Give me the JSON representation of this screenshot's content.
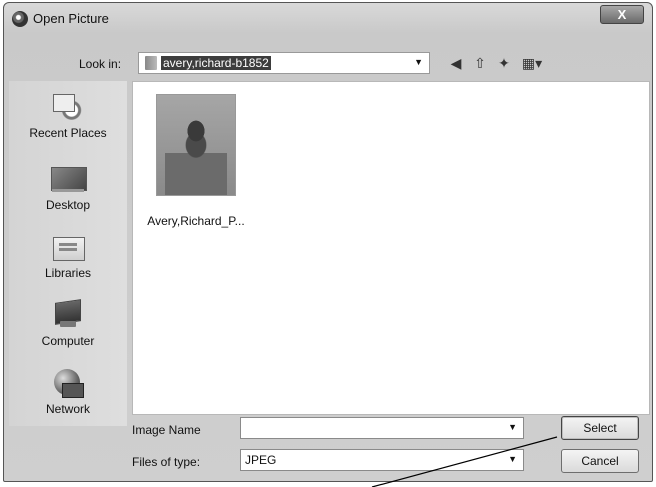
{
  "window": {
    "title": "Open Picture",
    "close_label": "X"
  },
  "toolbar": {
    "look_in_label": "Look in:",
    "look_in_value": "avery,richard-b1852",
    "icons": [
      "back-icon",
      "up-folder-icon",
      "new-folder-icon",
      "view-menu-icon"
    ]
  },
  "places": [
    {
      "label": "Recent Places",
      "icon": "recent-places-icon"
    },
    {
      "label": "Desktop",
      "icon": "desktop-icon"
    },
    {
      "label": "Libraries",
      "icon": "libraries-icon"
    },
    {
      "label": "Computer",
      "icon": "computer-icon"
    },
    {
      "label": "Network",
      "icon": "network-icon"
    }
  ],
  "files": [
    {
      "name": "Avery,Richard_P..."
    }
  ],
  "form": {
    "image_name_label": "Image Name",
    "image_name_value": "",
    "file_type_label": "Files of type:",
    "file_type_value": "JPEG"
  },
  "buttons": {
    "select": "Select",
    "cancel": "Cancel"
  }
}
